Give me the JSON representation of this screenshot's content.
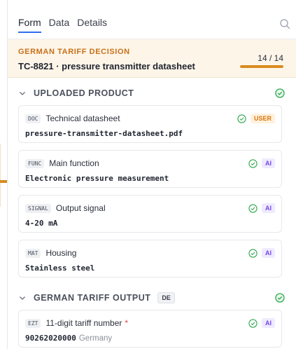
{
  "tabs": [
    "Form",
    "Data",
    "Details"
  ],
  "active_tab": "Form",
  "decision": {
    "kicker": "GERMAN TARIFF DECISION",
    "title": "TC-8821 · pressure transmitter datasheet",
    "count": "14 / 14",
    "progress_fraction": 1.0
  },
  "section_uploaded": {
    "title": "UPLOADED PRODUCT"
  },
  "section_output": {
    "title": "GERMAN TARIFF OUTPUT",
    "tag": "DE"
  },
  "fields": [
    {
      "code": "DOC",
      "label": "Technical datasheet",
      "source": "USER",
      "value": "pressure-transmitter-datasheet.pdf"
    },
    {
      "code": "FUNC",
      "label": "Main function",
      "source": "AI",
      "value": "Electronic pressure measurement"
    },
    {
      "code": "SIGNAL",
      "label": "Output signal",
      "source": "AI",
      "value": "4-20 mA"
    },
    {
      "code": "MAT",
      "label": "Housing",
      "source": "AI",
      "value": "Stainless steel"
    },
    {
      "code": "EZT",
      "label": "11-digit tariff number",
      "required": "*",
      "source": "AI",
      "value": "90262020000",
      "note": "Germany"
    }
  ],
  "colors": {
    "accent_orange": "#d98b1f",
    "tab_underline": "#2f6fed",
    "check_green": "#2fa84f",
    "ai_purple": "#7048e8"
  }
}
